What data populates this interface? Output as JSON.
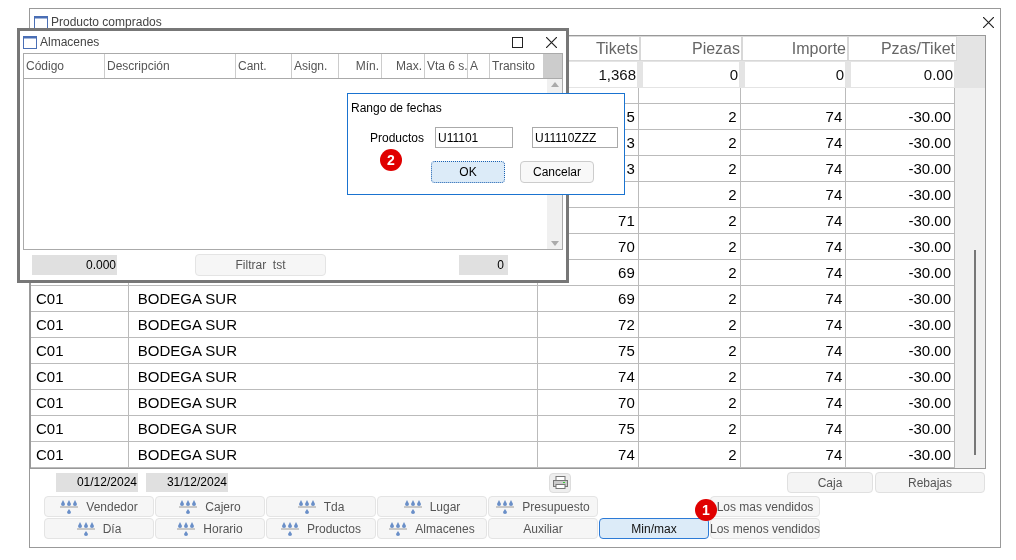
{
  "window": {
    "title": "Producto comprados"
  },
  "table": {
    "columns": [
      "Tikets",
      "Piezas",
      "Importe",
      "Pzas/Tiket"
    ],
    "totals": [
      "1,368",
      "0",
      "0",
      "0.00"
    ],
    "rows": [
      {
        "tikets": "5",
        "piezas": "2",
        "importe": "74",
        "pzas_tiket": "-30.00"
      },
      {
        "tikets": "3",
        "piezas": "2",
        "importe": "74",
        "pzas_tiket": "-30.00"
      },
      {
        "tikets": "3",
        "piezas": "2",
        "importe": "74",
        "pzas_tiket": "-30.00"
      },
      {
        "piezas": "2",
        "importe": "74",
        "pzas_tiket": "-30.00"
      },
      {
        "tikets": "71",
        "piezas": "2",
        "importe": "74",
        "pzas_tiket": "-30.00"
      },
      {
        "tikets": "70",
        "piezas": "2",
        "importe": "74",
        "pzas_tiket": "-30.00"
      },
      {
        "tikets": "69",
        "piezas": "2",
        "importe": "74",
        "pzas_tiket": "-30.00"
      },
      {
        "code": "C01",
        "description": "BODEGA SUR",
        "tikets": "69",
        "piezas": "2",
        "importe": "74",
        "pzas_tiket": "-30.00"
      },
      {
        "code": "C01",
        "description": "BODEGA SUR",
        "tikets": "72",
        "piezas": "2",
        "importe": "74",
        "pzas_tiket": "-30.00"
      },
      {
        "code": "C01",
        "description": "BODEGA SUR",
        "tikets": "75",
        "piezas": "2",
        "importe": "74",
        "pzas_tiket": "-30.00"
      },
      {
        "code": "C01",
        "description": "BODEGA SUR",
        "tikets": "74",
        "piezas": "2",
        "importe": "74",
        "pzas_tiket": "-30.00"
      },
      {
        "code": "C01",
        "description": "BODEGA SUR",
        "tikets": "70",
        "piezas": "2",
        "importe": "74",
        "pzas_tiket": "-30.00"
      },
      {
        "code": "C01",
        "description": "BODEGA SUR",
        "tikets": "75",
        "piezas": "2",
        "importe": "74",
        "pzas_tiket": "-30.00"
      },
      {
        "code": "C01",
        "description": "BODEGA SUR",
        "tikets": "74",
        "piezas": "2",
        "importe": "74",
        "pzas_tiket": "-30.00"
      }
    ]
  },
  "dates": {
    "from": "01/12/2024",
    "to": "31/12/2024"
  },
  "side_buttons": [
    "Caja",
    "Rebajas"
  ],
  "report_buttons": [
    [
      {
        "label": "Vendedor",
        "icon": true,
        "selected": false
      },
      {
        "label": "Cajero",
        "icon": true,
        "selected": false
      },
      {
        "label": "Tda",
        "icon": true,
        "selected": false
      },
      {
        "label": "Lugar",
        "icon": true,
        "selected": false
      },
      {
        "label": "Presupuesto",
        "icon": true,
        "selected": false
      },
      {
        "label": "Los mas vendidos",
        "icon": false,
        "selected": false
      }
    ],
    [
      {
        "label": "Día",
        "icon": true,
        "selected": false
      },
      {
        "label": "Horario",
        "icon": true,
        "selected": false
      },
      {
        "label": "Productos",
        "icon": true,
        "selected": false
      },
      {
        "label": "Almacenes",
        "icon": true,
        "selected": false
      },
      {
        "label": "Auxiliar",
        "icon": false,
        "selected": false
      },
      {
        "label": "Min/max",
        "icon": false,
        "selected": true
      },
      {
        "label": "Los menos vendidos",
        "icon": false,
        "selected": false
      }
    ]
  ],
  "report_badge": "1",
  "almacenes": {
    "title": "Almacenes",
    "columns": [
      "Código",
      "Descripción",
      "Cant.",
      "Asign.",
      "Mín.",
      "Max.",
      "Vta 6 s.",
      "A",
      "Transito"
    ],
    "total": "0.000",
    "button": "Filtrar  tst",
    "count": "0"
  },
  "range_dialog": {
    "title": "Rango de fechas",
    "label": "Productos",
    "from": "U11101",
    "to": "U11110ZZZ",
    "badge": "2",
    "buttons": [
      {
        "label": "OK",
        "selected": true
      },
      {
        "label": "Cancelar",
        "selected": false
      }
    ]
  }
}
